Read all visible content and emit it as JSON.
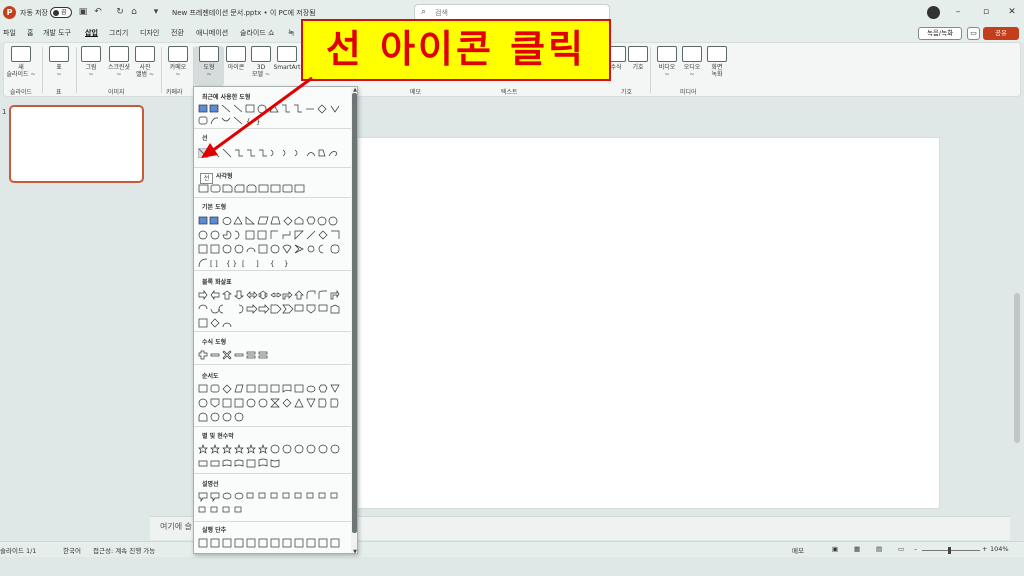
{
  "titlebar": {
    "autosave_label": "자동 저장",
    "autosave_state": "끔",
    "document_title": "New 프레젠테이션 문서.pptx • 이 PC에 저장됨",
    "search_placeholder": "검색"
  },
  "tabs": [
    "파일",
    "홈",
    "개발 도구",
    "삽입",
    "그리기",
    "디자인",
    "전환",
    "애니메이션",
    "슬라이드 쇼",
    "녹"
  ],
  "active_tab": "삽입",
  "tab_right": {
    "record": "녹음/녹화",
    "share": "공유"
  },
  "ribbon": {
    "buttons": [
      {
        "label": "새\n슬라이드 ~"
      },
      {
        "label": "표\n~"
      },
      {
        "label": "그림\n~"
      },
      {
        "label": "스크린샷\n~"
      },
      {
        "label": "사진\n앨범 ~"
      },
      {
        "label": "카메오\n~"
      },
      {
        "label": "도형\n~"
      },
      {
        "label": "아이콘"
      },
      {
        "label": "3D\n모델 ~"
      },
      {
        "label": "SmartArt"
      }
    ],
    "right_buttons": [
      {
        "label": "수식"
      },
      {
        "label": "기호"
      },
      {
        "label": "비디오\n~"
      },
      {
        "label": "오디오\n~"
      },
      {
        "label": "화면\n녹화"
      }
    ],
    "groups": [
      "슬라이드",
      "표",
      "이미지",
      "카메라",
      "메모",
      "텍스트",
      "기호",
      "미디어"
    ]
  },
  "callout": {
    "text": "선 아이콘 클릭",
    "bg_color": "#ffff00",
    "text_color": "#e00000"
  },
  "shapes_menu": {
    "sections": [
      "최근에 사용한 도형",
      "선",
      "사각형",
      "기본 도형",
      "블록 화살표",
      "수식 도형",
      "순서도",
      "별 및 현수막",
      "설명선",
      "실행 단추"
    ],
    "tooltip": "선"
  },
  "slides": {
    "number": "1"
  },
  "notes_placeholder": "여기에 슬",
  "statusbar": {
    "slide": "슬라이드 1/1",
    "language": "한국어",
    "accessibility": "접근성: 계속 진행 가능",
    "notes": "메모",
    "zoom": "104%"
  },
  "colors": {
    "accent": "#c43e1c",
    "background": "#dfe8e6"
  }
}
